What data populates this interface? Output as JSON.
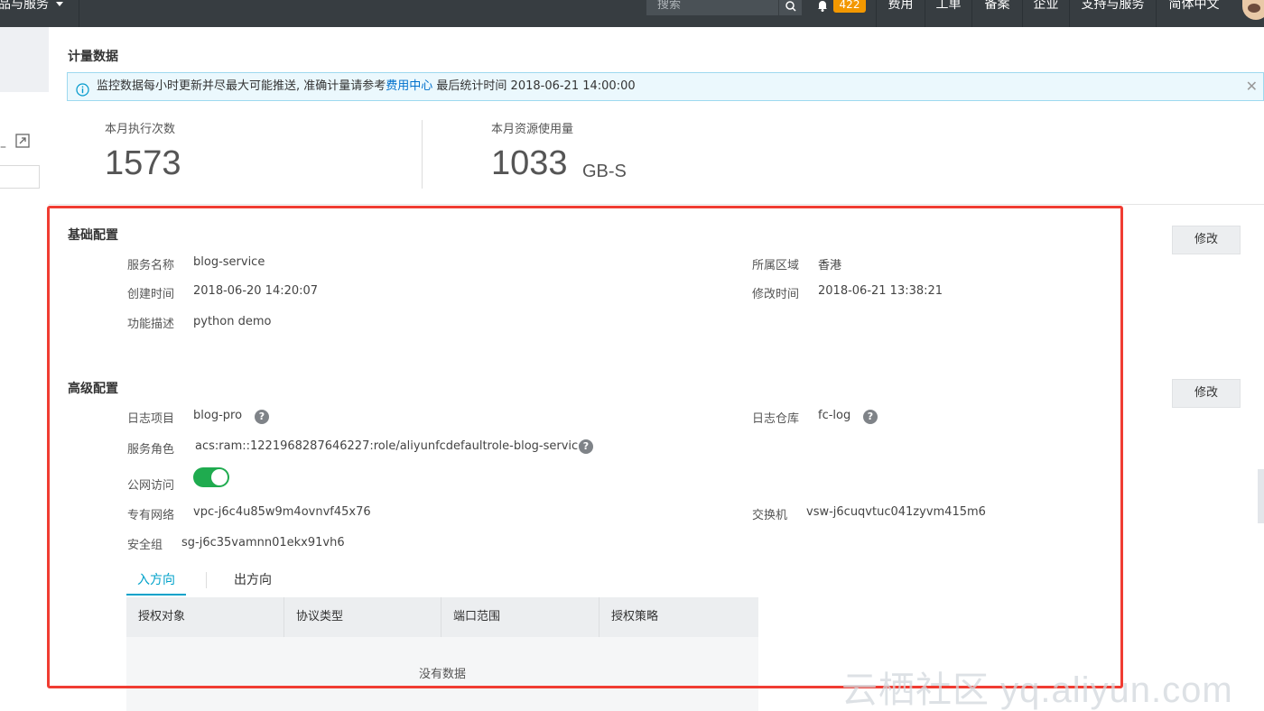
{
  "topbar": {
    "products": "品与服务",
    "search_placeholder": "搜索",
    "badge": "422",
    "nav": [
      "费用",
      "工单",
      "备案",
      "企业",
      "支持与服务",
      "简体中文"
    ]
  },
  "metering": {
    "title": "计量数据",
    "notice_prefix": "监控数据每小时更新并尽最大可能推送, 准确计量请参考",
    "notice_link": "费用中心",
    "notice_suffix": "最后统计时间  2018-06-21 14:00:00",
    "close": "✕",
    "exec_label": "本月执行次数",
    "exec_value": "1573",
    "usage_label": "本月资源使用量",
    "usage_value": "1033",
    "usage_unit": "GB-S"
  },
  "basic": {
    "title": "基础配置",
    "modify": "修改",
    "service_name_label": "服务名称",
    "service_name": "blog-service",
    "region_label": "所属区域",
    "region": "香港",
    "created_label": "创建时间",
    "created": "2018-06-20 14:20:07",
    "modified_label": "修改时间",
    "modified": "2018-06-21 13:38:21",
    "desc_label": "功能描述",
    "desc": "python demo"
  },
  "advanced": {
    "title": "高级配置",
    "modify": "修改",
    "log_project_label": "日志项目",
    "log_project": "blog-pro",
    "logstore_label": "日志仓库",
    "logstore": "fc-log",
    "role_label": "服务角色",
    "role": "acs:ram::1221968287646227:role/aliyunfcdefaultrole-blog-service",
    "internet_label": "公网访问",
    "internet_enabled": true,
    "vpc_label": "专有网络",
    "vpc": "vpc-j6c4u85w9m4ovnvf45x76",
    "vswitch_label": "交换机",
    "vswitch": "vsw-j6cuqvtuc041zyvm415m6",
    "sg_label": "安全组",
    "sg": "sg-j6c35vamnn01ekx91vh6",
    "help": "?"
  },
  "tabs": {
    "inbound": "入方向",
    "outbound": "出方向"
  },
  "table": {
    "columns": [
      "授权对象",
      "协议类型",
      "端口范围",
      "授权策略"
    ],
    "empty": "没有数据"
  },
  "watermark": "云栖社区 yq.aliyun.com"
}
